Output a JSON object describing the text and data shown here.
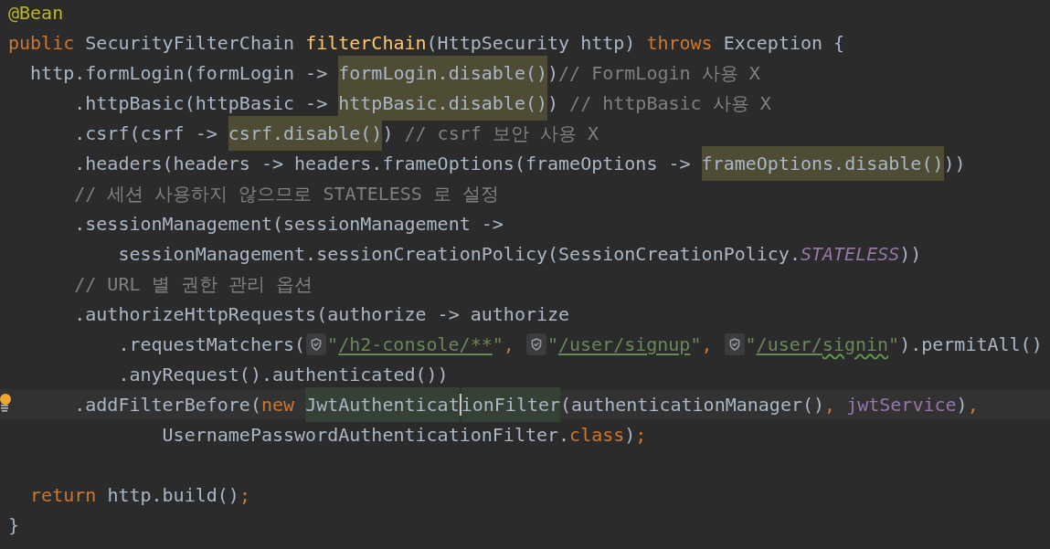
{
  "editor": {
    "lines": [
      {
        "bulb": false,
        "tokens": [
          {
            "kind": "annotation",
            "text": "@Bean"
          }
        ]
      },
      {
        "bulb": false,
        "tokens": [
          {
            "kind": "keyword",
            "text": "public "
          },
          {
            "kind": "plain",
            "text": "SecurityFilterChain "
          },
          {
            "kind": "declaration",
            "text": "filterChain"
          },
          {
            "kind": "plain",
            "text": "(HttpSecurity http) "
          },
          {
            "kind": "keyword",
            "text": "throws "
          },
          {
            "kind": "plain",
            "text": "Exception {"
          }
        ]
      },
      {
        "bulb": false,
        "tokens": [
          {
            "kind": "plain",
            "text": "  http.formLogin(formLogin -> "
          },
          {
            "kind": "highlight",
            "text": "formLogin.disable()"
          },
          {
            "kind": "plain",
            "text": ")"
          },
          {
            "kind": "comment",
            "text": "// FormLogin 사용 X"
          }
        ]
      },
      {
        "bulb": false,
        "tokens": [
          {
            "kind": "plain",
            "text": "      .httpBasic(httpBasic -> "
          },
          {
            "kind": "highlight",
            "text": "httpBasic.disable()"
          },
          {
            "kind": "plain",
            "text": ") "
          },
          {
            "kind": "comment",
            "text": "// httpBasic 사용 X"
          }
        ]
      },
      {
        "bulb": false,
        "tokens": [
          {
            "kind": "plain",
            "text": "      .csrf(csrf -> "
          },
          {
            "kind": "highlight",
            "text": "csrf.disable()"
          },
          {
            "kind": "plain",
            "text": ") "
          },
          {
            "kind": "comment",
            "text": "// csrf 보안 사용 X"
          }
        ]
      },
      {
        "bulb": false,
        "tokens": [
          {
            "kind": "plain",
            "text": "      .headers(headers -> headers.frameOptions(frameOptions -> "
          },
          {
            "kind": "highlight",
            "text": "frameOptions.disable()"
          },
          {
            "kind": "plain",
            "text": "))"
          }
        ]
      },
      {
        "bulb": false,
        "tokens": [
          {
            "kind": "comment",
            "text": "      // 세션 사용하지 않으므로 STATELESS 로 설정"
          }
        ]
      },
      {
        "bulb": false,
        "tokens": [
          {
            "kind": "plain",
            "text": "      .sessionManagement(sessionManagement ->"
          }
        ]
      },
      {
        "bulb": false,
        "tokens": [
          {
            "kind": "plain",
            "text": "          sessionManagement.sessionCreationPolicy(SessionCreationPolicy."
          },
          {
            "kind": "constant",
            "text": "STATELESS"
          },
          {
            "kind": "plain",
            "text": "))"
          }
        ]
      },
      {
        "bulb": false,
        "tokens": [
          {
            "kind": "comment",
            "text": "      // URL 별 권한 관리 옵션"
          }
        ]
      },
      {
        "bulb": false,
        "tokens": [
          {
            "kind": "plain",
            "text": "      .authorizeHttpRequests(authorize -> authorize"
          }
        ]
      },
      {
        "bulb": false,
        "tokens": [
          {
            "kind": "plain",
            "text": "          .requestMatchers("
          },
          {
            "kind": "inlay"
          },
          {
            "kind": "string",
            "text": "\""
          },
          {
            "kind": "url",
            "text": "/h2-console/**"
          },
          {
            "kind": "string",
            "text": "\""
          },
          {
            "kind": "keyword",
            "text": ", "
          },
          {
            "kind": "inlay"
          },
          {
            "kind": "string",
            "text": "\""
          },
          {
            "kind": "url",
            "text": "/user/signup"
          },
          {
            "kind": "string",
            "text": "\""
          },
          {
            "kind": "keyword",
            "text": ", "
          },
          {
            "kind": "inlay"
          },
          {
            "kind": "string",
            "text": "\""
          },
          {
            "kind": "url",
            "text": "/user/"
          },
          {
            "kind": "url_typo",
            "text": "signin"
          },
          {
            "kind": "string",
            "text": "\""
          },
          {
            "kind": "plain",
            "text": ").permitAll()"
          }
        ]
      },
      {
        "bulb": false,
        "tokens": [
          {
            "kind": "plain",
            "text": "          .anyRequest().authenticated())"
          }
        ]
      },
      {
        "bulb": true,
        "tokens": [
          {
            "kind": "plain",
            "text": "      .addFilterBefore("
          },
          {
            "kind": "keyword",
            "text": "new "
          },
          {
            "kind": "usage",
            "text": "JwtAuthenticat"
          },
          {
            "kind": "caret"
          },
          {
            "kind": "usage",
            "text": "ionFilter"
          },
          {
            "kind": "plain",
            "text": "(authenticationManager()"
          },
          {
            "kind": "keyword",
            "text": ", "
          },
          {
            "kind": "field",
            "text": "jwtService"
          },
          {
            "kind": "plain",
            "text": ")"
          },
          {
            "kind": "keyword",
            "text": ","
          }
        ]
      },
      {
        "bulb": false,
        "tokens": [
          {
            "kind": "plain",
            "text": "              UsernamePasswordAuthenticationFilter."
          },
          {
            "kind": "keyword",
            "text": "class"
          },
          {
            "kind": "plain",
            "text": ")"
          },
          {
            "kind": "keyword",
            "text": ";"
          }
        ]
      },
      {
        "bulb": false
      },
      {
        "bulb": false,
        "tokens": [
          {
            "kind": "keyword",
            "text": "  return "
          },
          {
            "kind": "plain",
            "text": "http.build()"
          },
          {
            "kind": "keyword",
            "text": ";"
          }
        ]
      },
      {
        "bulb": false,
        "tokens": [
          {
            "kind": "plain",
            "text": "}"
          }
        ]
      }
    ]
  }
}
